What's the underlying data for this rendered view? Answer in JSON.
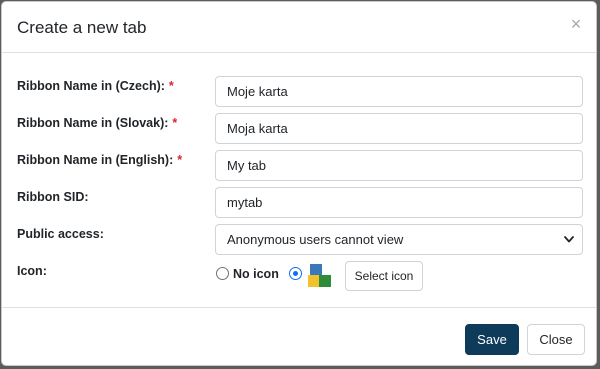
{
  "dialog": {
    "title": "Create a new tab",
    "close_glyph": "×"
  },
  "fields": {
    "name_cs": {
      "label": "Ribbon Name in (Czech):",
      "required": "*",
      "value": "Moje karta"
    },
    "name_sk": {
      "label": "Ribbon Name in (Slovak):",
      "required": "*",
      "value": "Moja karta"
    },
    "name_en": {
      "label": "Ribbon Name in (English):",
      "required": "*",
      "value": "My tab"
    },
    "sid": {
      "label": "Ribbon SID:",
      "value": "mytab"
    },
    "public_access": {
      "label": "Public access:",
      "selected": "Anonymous users cannot view"
    },
    "icon": {
      "label": "Icon:",
      "no_icon_label": "No icon",
      "selected_option": "custom icon",
      "preview_icon": "colored-squares-icon",
      "select_button": "Select icon"
    }
  },
  "footer": {
    "save": "Save",
    "close": "Close"
  },
  "colors": {
    "primary_button": "#0f3b5b",
    "required_asterisk": "#d9262b",
    "radio_active": "#0d6efd"
  }
}
